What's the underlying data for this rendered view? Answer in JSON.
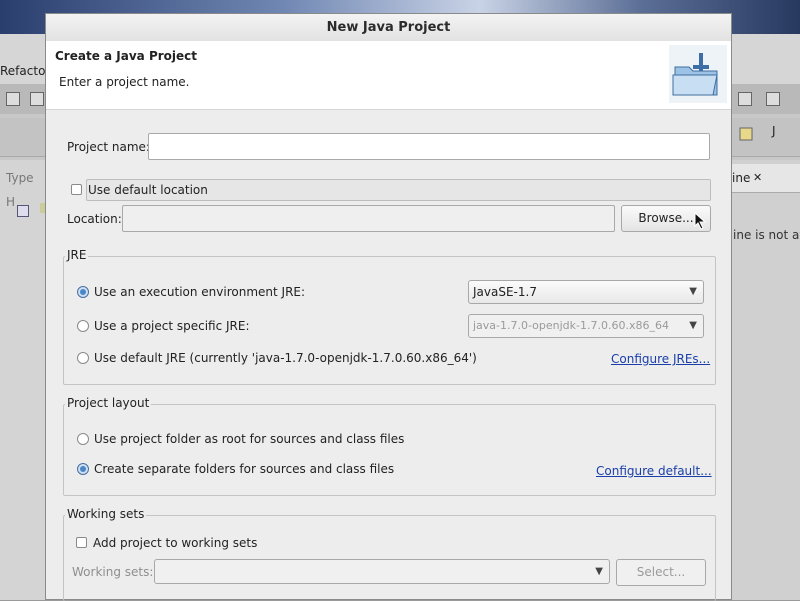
{
  "background": {
    "menu_partial": "Refactor",
    "left_tab_partial": "Type H",
    "right_tab_partial": "ine",
    "right_tab_close": "✕",
    "right_text_partial": "ine is not ava",
    "right_button_partial": "J"
  },
  "dialog": {
    "title": "New Java Project",
    "banner": {
      "title": "Create a Java Project",
      "subtitle": "Enter a project name.",
      "icon": "folder-icon"
    },
    "project_name": {
      "label": "Project name:",
      "value": "",
      "placeholder": ""
    },
    "use_default_location": {
      "label": "Use default location",
      "checked": false
    },
    "location": {
      "label": "Location:",
      "value": "",
      "browse_label": "Browse..."
    },
    "jre": {
      "title": "JRE",
      "option_exec_env": {
        "label": "Use an execution environment JRE:",
        "selected": true,
        "combo_value": "JavaSE-1.7"
      },
      "option_project_specific": {
        "label": "Use a project specific JRE:",
        "selected": false,
        "combo_value": "java-1.7.0-openjdk-1.7.0.60.x86_64"
      },
      "option_default": {
        "label": "Use default JRE (currently 'java-1.7.0-openjdk-1.7.0.60.x86_64')",
        "selected": false
      },
      "configure_link": "Configure JREs..."
    },
    "project_layout": {
      "title": "Project layout",
      "option_root": {
        "label": "Use project folder as root for sources and class files",
        "selected": false
      },
      "option_separate": {
        "label": "Create separate folders for sources and class files",
        "selected": true
      },
      "configure_link": "Configure default..."
    },
    "working_sets": {
      "title": "Working sets",
      "add_checkbox": {
        "label": "Add project to working sets",
        "checked": false
      },
      "sets_label": "Working sets:",
      "sets_value": "",
      "select_label": "Select..."
    }
  },
  "colors": {
    "link": "#1a3fa8",
    "radio_selected": "#4a86c8"
  }
}
